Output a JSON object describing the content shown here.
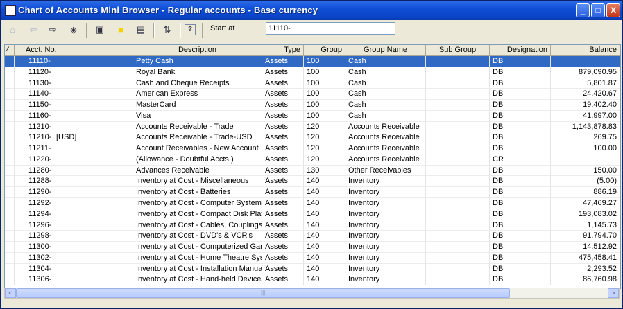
{
  "window": {
    "title": "Chart of Accounts Mini Browser - Regular accounts - Base currency"
  },
  "titlebar_buttons": {
    "minimize": "_",
    "maximize": "□",
    "close": "X"
  },
  "toolbar": {
    "tools": [
      {
        "name": "home-icon",
        "glyph": "⌂",
        "disabled": true
      },
      {
        "name": "back-arrow-icon",
        "glyph": "⇦",
        "disabled": true
      },
      {
        "name": "forward-arrow-icon",
        "glyph": "⇨",
        "disabled": false
      },
      {
        "name": "navigate-diamond-icon",
        "glyph": "◈",
        "disabled": false
      },
      {
        "name": "refresh-page-icon",
        "glyph": "▣",
        "disabled": false
      },
      {
        "name": "note-icon",
        "glyph": "■",
        "disabled": false
      },
      {
        "name": "document-list-icon",
        "glyph": "▤",
        "disabled": false
      },
      {
        "name": "sort-arrows-icon",
        "glyph": "⇅",
        "disabled": false
      },
      {
        "name": "help-icon",
        "glyph": "?",
        "disabled": false
      }
    ],
    "start_at_label": "Start at",
    "start_at_value": "11110-"
  },
  "colors": {
    "selection": "#316ac5",
    "titlebar": "#0a43c6",
    "note_icon": "#f7d000"
  },
  "table": {
    "columns": [
      "Acct. No.",
      "Description",
      "Type",
      "Group",
      "Group Name",
      "Sub Group",
      "Designation",
      "Balance"
    ],
    "rows": [
      {
        "acct": "11110-",
        "cur": "",
        "desc": "Petty Cash",
        "type": "Assets",
        "group": "100",
        "gname": "Cash",
        "sub": "",
        "des": "DB",
        "bal": "",
        "selected": true
      },
      {
        "acct": "11120-",
        "cur": "",
        "desc": "Royal Bank",
        "type": "Assets",
        "group": "100",
        "gname": "Cash",
        "sub": "",
        "des": "DB",
        "bal": "879,090.95"
      },
      {
        "acct": "11130-",
        "cur": "",
        "desc": "Cash and Cheque Receipts",
        "type": "Assets",
        "group": "100",
        "gname": "Cash",
        "sub": "",
        "des": "DB",
        "bal": "5,801.87"
      },
      {
        "acct": "11140-",
        "cur": "",
        "desc": "American Express",
        "type": "Assets",
        "group": "100",
        "gname": "Cash",
        "sub": "",
        "des": "DB",
        "bal": "24,420.67"
      },
      {
        "acct": "11150-",
        "cur": "",
        "desc": "MasterCard",
        "type": "Assets",
        "group": "100",
        "gname": "Cash",
        "sub": "",
        "des": "DB",
        "bal": "19,402.40"
      },
      {
        "acct": "11160-",
        "cur": "",
        "desc": "Visa",
        "type": "Assets",
        "group": "100",
        "gname": "Cash",
        "sub": "",
        "des": "DB",
        "bal": "41,997.00"
      },
      {
        "acct": "11210-",
        "cur": "",
        "desc": "Accounts Receivable - Trade",
        "type": "Assets",
        "group": "120",
        "gname": "Accounts Receivable",
        "sub": "",
        "des": "DB",
        "bal": "1,143,878.83"
      },
      {
        "acct": "11210-",
        "cur": "[USD]",
        "desc": "Accounts Receivable - Trade-USD",
        "type": "Assets",
        "group": "120",
        "gname": "Accounts Receivable",
        "sub": "",
        "des": "DB",
        "bal": "269.75"
      },
      {
        "acct": "11211-",
        "cur": "",
        "desc": "Account Receivables - New Account",
        "type": "Assets",
        "group": "120",
        "gname": "Accounts Receivable",
        "sub": "",
        "des": "DB",
        "bal": "100.00"
      },
      {
        "acct": "11220-",
        "cur": "",
        "desc": "(Allowance - Doubtful Accts.)",
        "type": "Assets",
        "group": "120",
        "gname": "Accounts Receivable",
        "sub": "",
        "des": "CR",
        "bal": ""
      },
      {
        "acct": "11280-",
        "cur": "",
        "desc": "Advances Receivable",
        "type": "Assets",
        "group": "130",
        "gname": "Other Receivables",
        "sub": "",
        "des": "DB",
        "bal": "150.00"
      },
      {
        "acct": "11288-",
        "cur": "",
        "desc": "Inventory at Cost - Miscellaneous",
        "type": "Assets",
        "group": "140",
        "gname": "Inventory",
        "sub": "",
        "des": "DB",
        "bal": "(5.00)"
      },
      {
        "acct": "11290-",
        "cur": "",
        "desc": "Inventory at Cost - Batteries",
        "type": "Assets",
        "group": "140",
        "gname": "Inventory",
        "sub": "",
        "des": "DB",
        "bal": "886.19"
      },
      {
        "acct": "11292-",
        "cur": "",
        "desc": "Inventory at Cost - Computer Systems ...",
        "type": "Assets",
        "group": "140",
        "gname": "Inventory",
        "sub": "",
        "des": "DB",
        "bal": "47,469.27"
      },
      {
        "acct": "11294-",
        "cur": "",
        "desc": "Inventory at Cost - Compact Disk Play...",
        "type": "Assets",
        "group": "140",
        "gname": "Inventory",
        "sub": "",
        "des": "DB",
        "bal": "193,083.02"
      },
      {
        "acct": "11296-",
        "cur": "",
        "desc": "Inventory at Cost - Cables, Couplings ...",
        "type": "Assets",
        "group": "140",
        "gname": "Inventory",
        "sub": "",
        "des": "DB",
        "bal": "1,145.73"
      },
      {
        "acct": "11298-",
        "cur": "",
        "desc": "Inventory at Cost - DVD's & VCR's",
        "type": "Assets",
        "group": "140",
        "gname": "Inventory",
        "sub": "",
        "des": "DB",
        "bal": "91,794.70"
      },
      {
        "acct": "11300-",
        "cur": "",
        "desc": "Inventory at Cost - Computerized Gam...",
        "type": "Assets",
        "group": "140",
        "gname": "Inventory",
        "sub": "",
        "des": "DB",
        "bal": "14,512.92"
      },
      {
        "acct": "11302-",
        "cur": "",
        "desc": "Inventory at Cost - Home Theatre Sys...",
        "type": "Assets",
        "group": "140",
        "gname": "Inventory",
        "sub": "",
        "des": "DB",
        "bal": "475,458.41"
      },
      {
        "acct": "11304-",
        "cur": "",
        "desc": "Inventory at Cost - Installation Manuals",
        "type": "Assets",
        "group": "140",
        "gname": "Inventory",
        "sub": "",
        "des": "DB",
        "bal": "2,293.52"
      },
      {
        "acct": "11306-",
        "cur": "",
        "desc": "Inventory at Cost - Hand-held Devices",
        "type": "Assets",
        "group": "140",
        "gname": "Inventory",
        "sub": "",
        "des": "DB",
        "bal": "86,760.98"
      }
    ]
  },
  "scrollbar": {
    "left_arrow": "<",
    "right_arrow": ">",
    "grip": "|||"
  }
}
